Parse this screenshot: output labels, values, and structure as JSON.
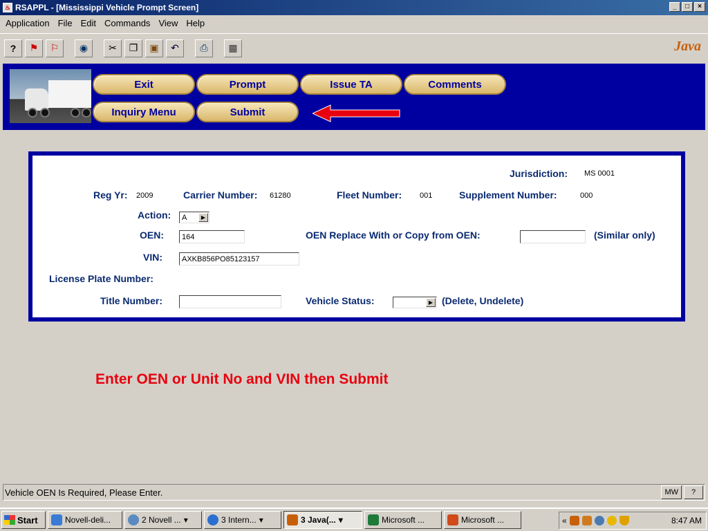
{
  "window": {
    "title": "RSAPPL - [Mississippi Vehicle Prompt Screen]",
    "controls": [
      "_",
      "□",
      "×"
    ]
  },
  "menu": {
    "items": [
      "Application",
      "File",
      "Edit",
      "Commands",
      "View",
      "Help"
    ]
  },
  "toolbar": {
    "icons": [
      "help-icon",
      "flag-red-icon",
      "flag-message-icon",
      "eye-icon",
      "cut-icon",
      "copy-icon",
      "paste-icon",
      "undo-icon",
      "print-icon",
      "calculator-icon"
    ],
    "logo_text": "Java"
  },
  "nav": {
    "exit": "Exit",
    "prompt": "Prompt",
    "issue_ta": "Issue TA",
    "comments": "Comments",
    "inquiry_menu": "Inquiry Menu",
    "submit": "Submit",
    "arrow_color": "#e8000e"
  },
  "form": {
    "jurisdiction_label": "Jurisdiction:",
    "jurisdiction_value": "MS 0001",
    "reg_yr_label": "Reg Yr:",
    "reg_yr_value": "2009",
    "carrier_number_label": "Carrier Number:",
    "carrier_number_value": "61280",
    "fleet_number_label": "Fleet Number:",
    "fleet_number_value": "001",
    "supplement_number_label": "Supplement Number:",
    "supplement_number_value": "000",
    "action_label": "Action:",
    "action_value": "A",
    "oen_label": "OEN:",
    "oen_value": "164",
    "oen_replace_label": "OEN Replace With or Copy from OEN:",
    "oen_replace_value": "",
    "similar_only": "(Similar only)",
    "vin_label": "VIN:",
    "vin_value": "AXKB856PO85123157",
    "license_plate_label": "License Plate Number:",
    "title_number_label": "Title Number:",
    "title_number_value": "",
    "vehicle_status_label": "Vehicle Status:",
    "vehicle_status_value": "",
    "delete_undelete": "(Delete, Undelete)"
  },
  "instruction": "Enter OEN or Unit No and VIN then Submit",
  "status": {
    "message": "Vehicle OEN Is Required, Please Enter.",
    "mode": "MW",
    "help": "?"
  },
  "taskbar": {
    "start": "Start",
    "tasks": [
      {
        "label": "Novell-deli...",
        "icon": "novell-icon",
        "color": "#3a7bd5"
      },
      {
        "label": "2 Novell ...",
        "icon": "novell-group-icon",
        "color": "#5a8ac0"
      },
      {
        "label": "3 Intern...",
        "icon": "internet-explorer-icon",
        "color": "#2a6fd0"
      },
      {
        "label": "3 Java(...",
        "icon": "java-icon",
        "color": "#c8600a"
      },
      {
        "label": "Microsoft ...",
        "icon": "excel-icon",
        "color": "#1e7a3a"
      },
      {
        "label": "Microsoft ...",
        "icon": "powerpoint-icon",
        "color": "#d04a1a"
      }
    ],
    "tray_expand": "«",
    "clock": "8:47 AM"
  }
}
